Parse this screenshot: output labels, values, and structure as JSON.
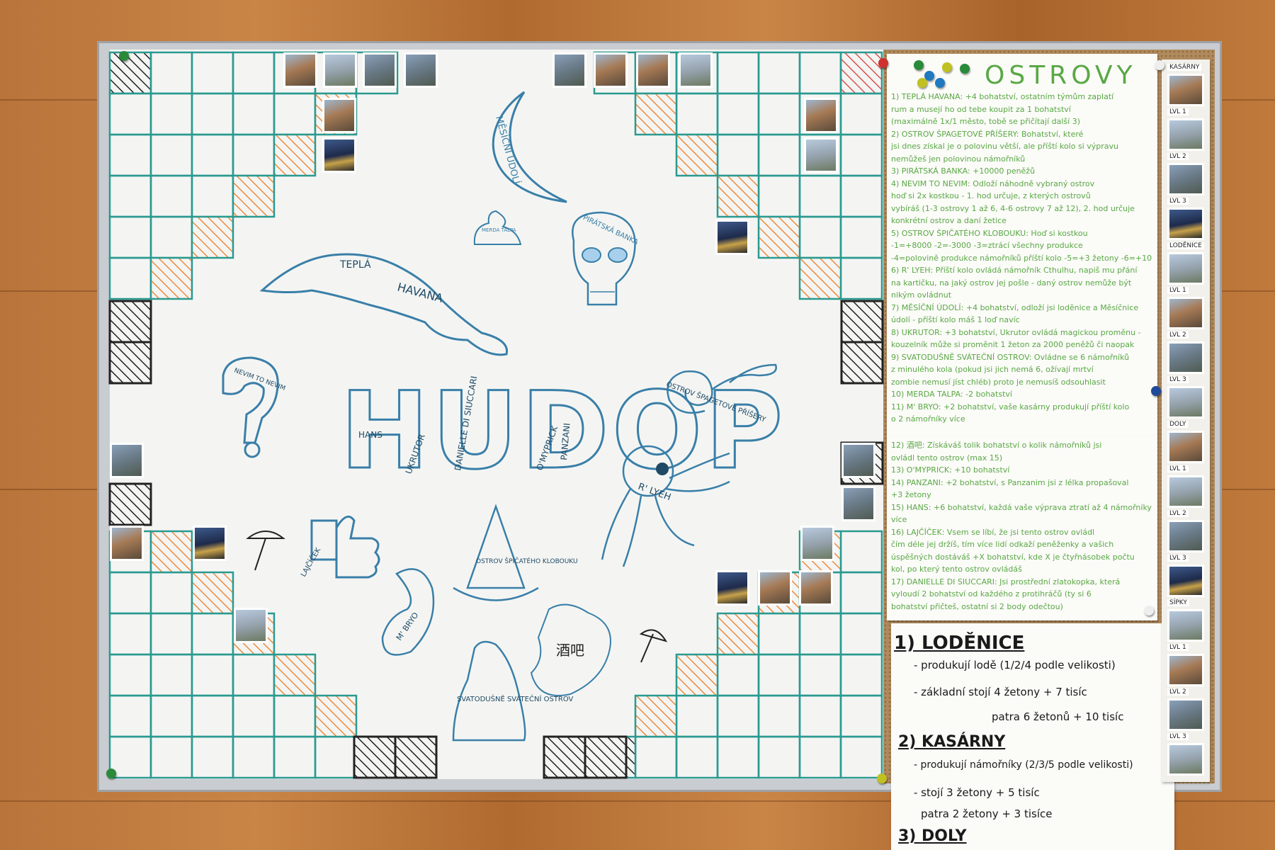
{
  "board": {
    "title": "HUDOP",
    "title_names": [
      "HANS",
      "UKRUTOR",
      "DANIELLE DI SIUCCARI",
      "O'MYPRICK",
      "PANZANI"
    ],
    "islands": {
      "mesicni_udoli": "MĚSÍČNÍ ÚDOLÍ",
      "merda_talpa": "MERDA TALPA",
      "piratska_banka": "PIRÁTSKÁ BANKA",
      "tepla": "TEPLÁ",
      "havana": "HAVANA",
      "nevim": "NEVIM TO NEVIM",
      "ostrov_spagetove": "OSTROV ŠPAGETOVÉ PŘÍŠERY",
      "rlyeh": "R' LYEH",
      "lajcicek": "LAJČÍČEK",
      "ostrov_spicateho": "OSTROV ŠPIČATÉHO KLOBOUKU",
      "mbryo": "M' BRYO",
      "jiuba": "酒吧",
      "svatodusne": "SVATODUŠNĚ SVÁTEČNÍ OSTROV"
    },
    "colors": {
      "grid": "#2a9a90",
      "hatch_orange": "#f08a3c",
      "hatch_black": "#222222",
      "hatch_red": "#d9534f",
      "ink_blue": "#3a7fa8"
    }
  },
  "rules": {
    "title": "OSTROVY",
    "lines": [
      "1) TEPLÁ HAVANA: +4 bohatství, ostatním týmům zaplatí",
      "rum a musejí ho od tebe koupit za 1 bohatství",
      "(maximálně 1x/1 město, tobě se přičítají další 3)",
      "2) OSTROV ŠPAGETOVÉ PŘÍŠERY: Bohatství, které",
      "jsi dnes získal je o polovinu větší, ale příští kolo si výpravu",
      "nemůžeš jen polovinou námořníků",
      "3) PIRÁTSKÁ BANKA: +10000 peněžů",
      "4) NEVIM TO NEVIM: Odloží náhodně vybraný ostrov",
      "hoď si 2x kostkou - 1. hod určuje, z kterých ostrovů",
      "vybíráš (1-3 ostrovy 1 až 6, 4-6 ostrovy 7 až 12), 2. hod určuje",
      "konkrétní ostrov a daní žetice",
      "5) OSTROV ŠPIČATÉHO KLOBOUKU: Hoď si kostkou",
      "-1=+8000    -2=-3000    -3=ztrácí všechny produkce",
      "-4=polovině produkce námořníků příští kolo   -5=+3 žetony   -6=+10 bohatství",
      "6) R' LYEH: Příští kolo ovládá námořník Cthulhu, napiš mu přání",
      "na kartičku, na jaký ostrov jej pošle - daný ostrov nemůže být",
      "nikým ovládnut",
      "7) MĚSÍČNÍ ÚDOLÍ: +4 bohatství, odloží jsi loděnice a Měsíčnice",
      "údolí - příští kolo máš 1 loď navíc",
      "8) UKRUTOR: +3 bohatství, Ukrutor ovládá magickou proměnu -",
      "kouzelník může si proměnit 1 žeton za 2000 peněžů či naopak",
      "9) SVATODUŠNĚ SVÁTEČNÍ OSTROV: Ovládne se 6 námořníků",
      "z minulého kola (pokud jsi jich nemá 6, ožívají mrtví",
      "zombie nemusí jíst chléb) proto je nemusíš odsouhlasit",
      "10) MERDA TALPA: -2 bohatství",
      "11) M' BRYO: +2 bohatství, vaše kasárny produkují příští kolo",
      "o 2 námořníky více"
    ],
    "lines2": [
      "12) 酒吧: Získáváš tolik bohatství o kolik námořníků jsi",
      "ovládl tento ostrov (max 15)",
      "13) O'MYPRICK: +10 bohatství",
      "14) PANZANI: +2 bohatství, s Panzanim jsi z lélka propašoval",
      "+3 žetony",
      "15) HANS: +6 bohatství, každá vaše výprava ztratí až 4 námořníky",
      "více",
      "16) LAJČÍČEK: Vsem se líbí, že jsi tento ostrov ovládl",
      "čím déle jej držíš, tím více lidí odkaží peněženky a vašich",
      "úspěšných dostáváš +X bohatství, kde X je čtyřnásobek počtu",
      "kol, po který tento ostrov ovládáš",
      "17) DANIELLE DI SIUCCARI: Jsi prostřední zlatokopka, která",
      "vyloudí 2 bohatství od každého z protihráčů (ty si 6",
      "bohatství přičteš, ostatní si 2 body odečtou)"
    ]
  },
  "buildings": {
    "lodenice_title": "1) LODĚNICE",
    "lodenice_l1": "- produkují lodě (1/2/4 podle velikosti)",
    "lodenice_l2": "- základní stojí 4 žetony + 7 tisíc",
    "lodenice_l3": "patra 6 žetonů + 10 tisíc",
    "kasarny_title": "2) KASÁRNY",
    "kasarny_l1": "- produkují námořníky (2/3/5 podle velikosti)",
    "kasarny_l2": "- stojí 3 žetony + 5 tisíc",
    "kasarny_l3": "patra 2 žetony + 3 tisíce",
    "doly_title": "3) DOLY"
  },
  "strip": {
    "labels": [
      "KASÁRNY",
      "LVL 1",
      "LVL 2",
      "LVL 3",
      "LODĚNICE",
      "LVL 1",
      "LVL 2",
      "LVL 3",
      "DOLY",
      "LVL 1",
      "LVL 2",
      "LVL 3",
      "SÍPKY",
      "LVL 1",
      "LVL 2",
      "LVL 3"
    ]
  }
}
